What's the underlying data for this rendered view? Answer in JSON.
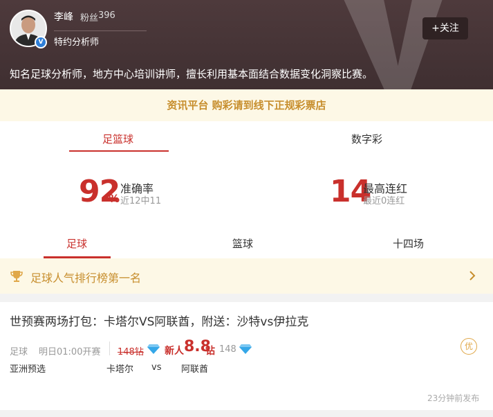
{
  "profile": {
    "name": "李峰",
    "fans_label": "粉丝",
    "fans_count": "396",
    "role": "特约分析师",
    "follow_label": "+关注",
    "bio": "知名足球分析师，地方中心培训讲师，擅长利用基本面结合数据变化洞察比赛。",
    "verified_mark": "V"
  },
  "notice": "资讯平台 购彩请到线下正规彩票店",
  "top_tabs": [
    {
      "label": "足篮球",
      "active": true
    },
    {
      "label": "数字彩",
      "active": false
    }
  ],
  "stats": {
    "accuracy": {
      "value": "92",
      "unit": "%",
      "label": "准确率",
      "sub": "近12中11"
    },
    "streak": {
      "value": "14",
      "label": "最高连红",
      "sub": "最近0连红"
    }
  },
  "sub_tabs": [
    {
      "label": "足球",
      "active": true
    },
    {
      "label": "篮球",
      "active": false
    },
    {
      "label": "十四场",
      "active": false
    }
  ],
  "ranking": {
    "text": "足球人气排行榜第一名"
  },
  "article": {
    "title": "世预赛两场打包：卡塔尔VS阿联酋，附送：沙特vs伊拉克",
    "sport": "足球",
    "kickoff": "明日01:00开赛",
    "old_price": "148钻",
    "new_label": "新人",
    "new_price": "8.8",
    "new_unit": "钻",
    "count": "148",
    "badge": "优",
    "league": "亚洲预选",
    "home": "卡塔尔",
    "vs": "vs",
    "away": "阿联酋",
    "posted": "23分钟前发布"
  },
  "colors": {
    "accent": "#c9302c",
    "gold": "#c78e2d",
    "header_bg": "#4e3a3c",
    "notice_bg": "#fdf8e6",
    "gem": "#35a7e8"
  },
  "icons": {
    "trophy": "trophy-icon",
    "chevron": "chevron-right-icon",
    "gem": "diamond-icon",
    "verified": "verified-badge-icon"
  }
}
